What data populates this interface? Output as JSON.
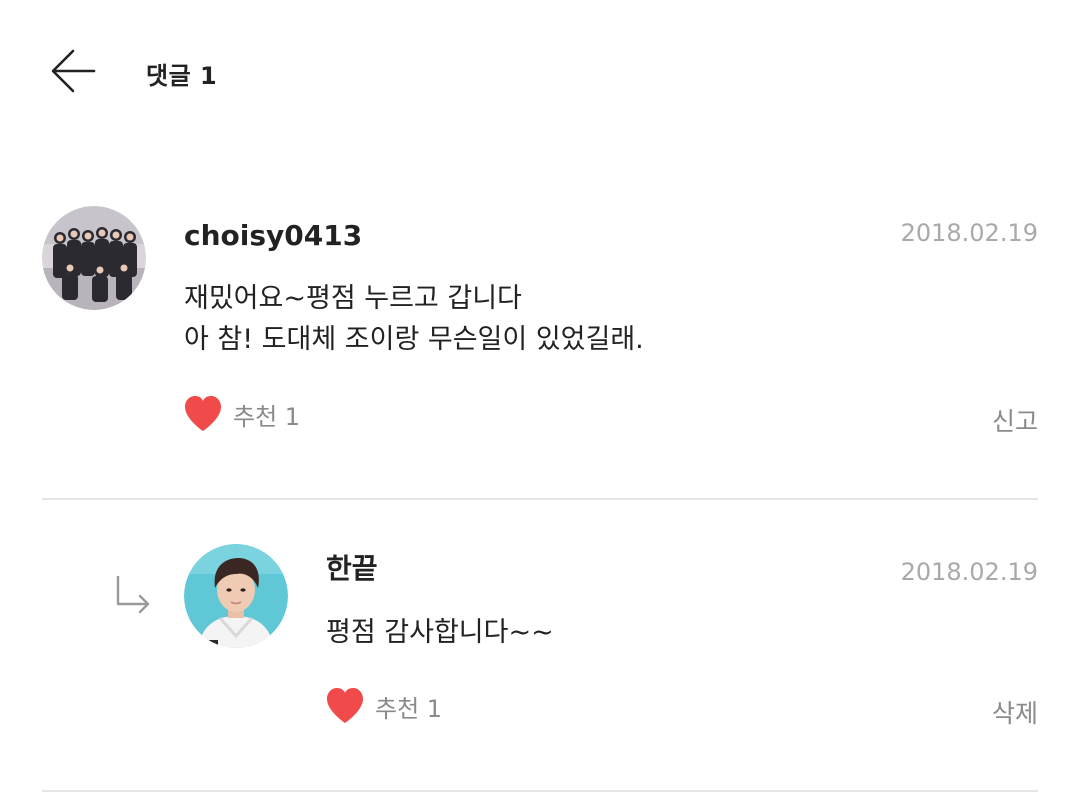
{
  "header": {
    "back_icon": "arrow-left-icon",
    "title": "댓글 1"
  },
  "comments": [
    {
      "username": "choisy0413",
      "date": "2018.02.19",
      "text": "재밌어요~평점 누르고 갑니다\n아 참! 도대체 조이랑 무슨일이  있었길래.",
      "like_label": "추천 1",
      "action_label": "신고",
      "avatar_icon": "group-photo-avatar"
    }
  ],
  "replies": [
    {
      "username": "한끝",
      "date": "2018.02.19",
      "text": "평점 감사합니다~~",
      "like_label": "추천 1",
      "action_label": "삭제",
      "avatar_icon": "portrait-avatar",
      "reply_icon": "reply-arrow-icon"
    }
  ],
  "colors": {
    "heart": "#f04a4a",
    "muted_text": "#8a8a8a",
    "date_text": "#a9a9a9",
    "divider": "#e6e6e6"
  }
}
